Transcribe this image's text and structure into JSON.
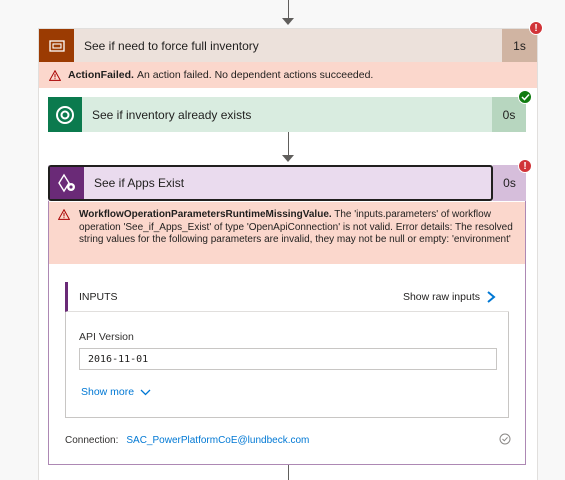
{
  "steps": [
    {
      "title": "See if need to force full inventory",
      "duration": "1s",
      "status": "failed",
      "color": "#9b3b02",
      "icon": "condition-icon"
    },
    {
      "title": "See if inventory already exists",
      "duration": "0s",
      "status": "succeeded",
      "color": "#0b7a4e",
      "icon": "dataverse-icon"
    },
    {
      "title": "See if Apps Exist",
      "duration": "0s",
      "status": "failed",
      "color": "#6a2a77",
      "icon": "power-platform-admin-icon"
    }
  ],
  "errors": {
    "step1": {
      "code": "ActionFailed.",
      "message": "An action failed. No dependent actions succeeded."
    },
    "step3": {
      "code": "WorkflowOperationParametersRuntimeMissingValue.",
      "message": "The 'inputs.parameters' of workflow operation 'See_if_Apps_Exist' of type 'OpenApiConnection' is not valid. Error details: The resolved string values for the following parameters are invalid, they may not be null or empty: 'environment'"
    }
  },
  "inputs": {
    "header": "INPUTS",
    "show_raw": "Show raw inputs",
    "fields": [
      {
        "label": "API Version",
        "value": "2016-11-01"
      }
    ],
    "show_more": "Show more"
  },
  "connection": {
    "label": "Connection:",
    "value": "SAC_PowerPlatformCoE@lundbeck.com"
  },
  "colors": {
    "error": "#d13438",
    "success": "#107c10",
    "link": "#0078d4"
  }
}
